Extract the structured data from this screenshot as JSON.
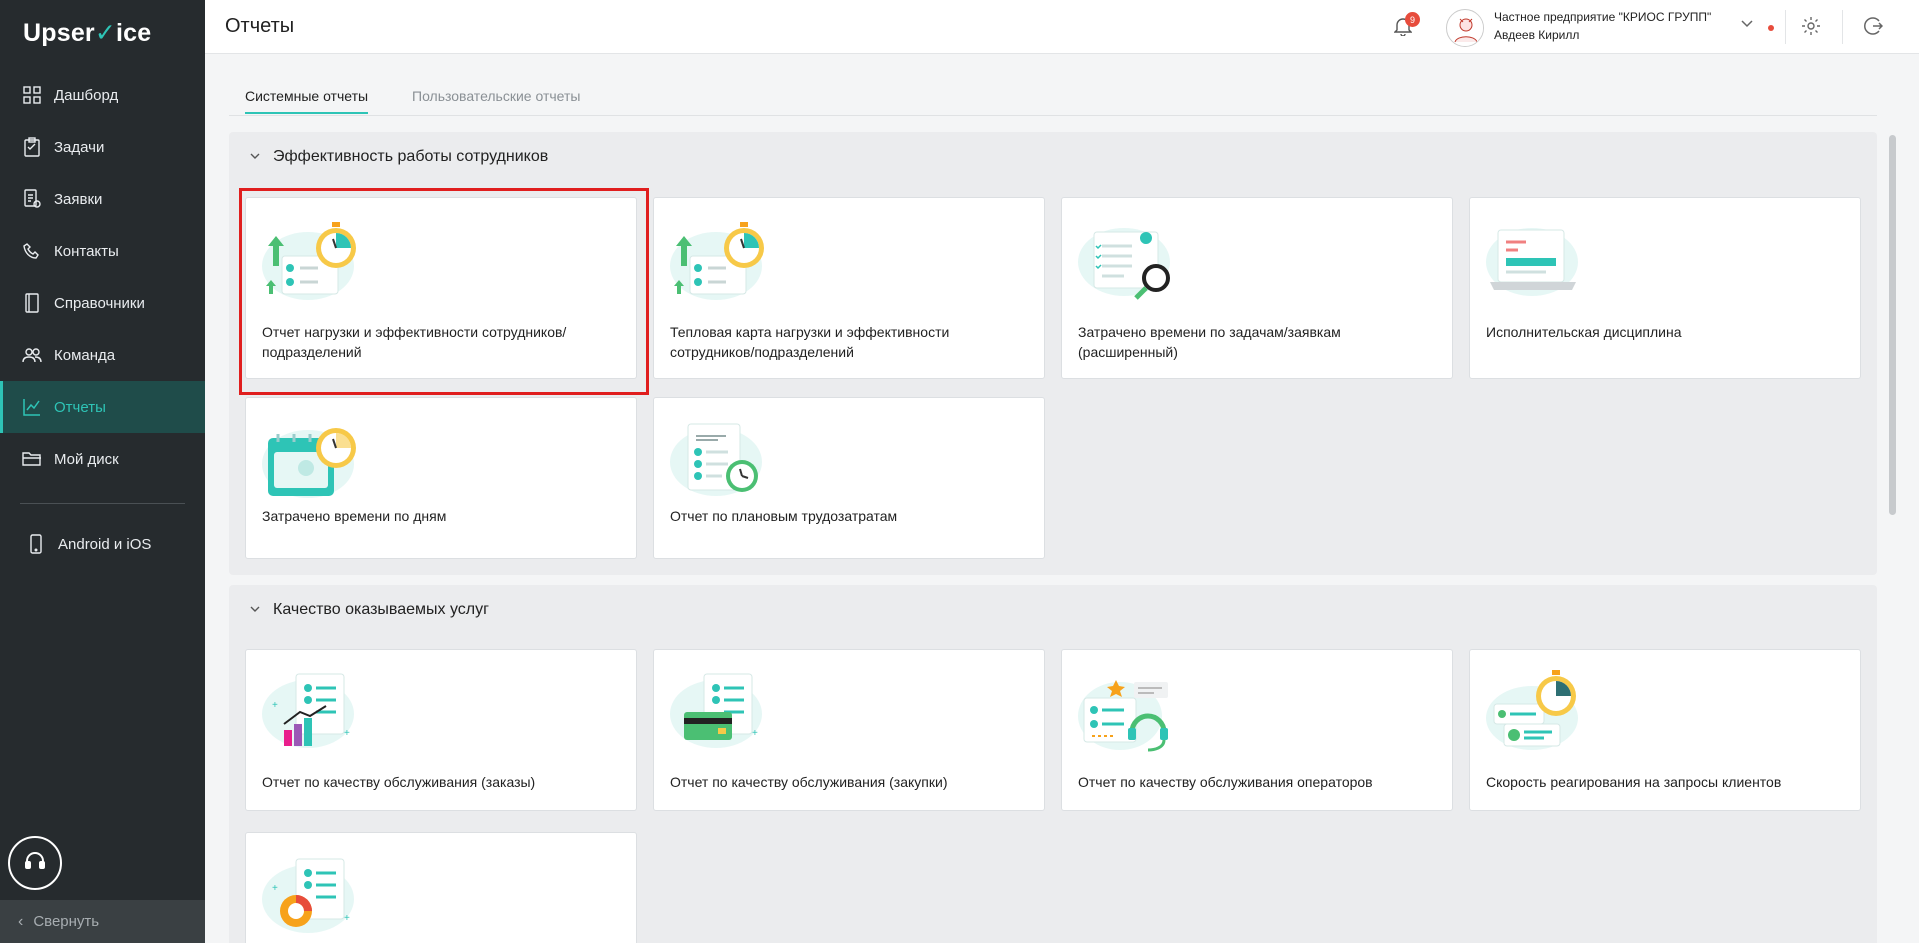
{
  "app": {
    "logo_text_before": "Upser",
    "logo_check": "✓",
    "logo_text_after": "ice"
  },
  "sidebar": {
    "items": [
      {
        "label": "Дашборд",
        "icon": "grid-icon"
      },
      {
        "label": "Задачи",
        "icon": "clipboard-icon"
      },
      {
        "label": "Заявки",
        "icon": "requests-icon"
      },
      {
        "label": "Контакты",
        "icon": "phone-icon"
      },
      {
        "label": "Справочники",
        "icon": "book-icon"
      },
      {
        "label": "Команда",
        "icon": "team-icon"
      },
      {
        "label": "Отчеты",
        "icon": "chart-line-icon",
        "active": true
      },
      {
        "label": "Мой диск",
        "icon": "folder-icon"
      }
    ],
    "mobile": {
      "label": "Android и iOS",
      "icon": "mobile-icon"
    },
    "collapse_label": "Свернуть"
  },
  "header": {
    "title": "Отчеты",
    "notifications_count": "9",
    "company": "Частное предприятие \"КРИОС ГРУПП\"",
    "user": "Авдеев Кирилл"
  },
  "tabs": [
    {
      "label": "Системные отчеты",
      "active": true
    },
    {
      "label": "Пользовательские отчеты",
      "active": false
    }
  ],
  "sections": [
    {
      "title": "Эффективность работы сотрудников",
      "cards": [
        {
          "label": "Отчет нагрузки и эффективности сотрудников/подразделений"
        },
        {
          "label": "Тепловая карта нагрузки и эффективности сотрудников/подразделений"
        },
        {
          "label": "Затрачено времени по задачам/заявкам (расширенный)"
        },
        {
          "label": "Исполнительская дисциплина"
        },
        {
          "label": "Затрачено времени по дням"
        },
        {
          "label": "Отчет по плановым трудозатратам"
        }
      ]
    },
    {
      "title": "Качество оказываемых услуг",
      "cards": [
        {
          "label": "Отчет по качеству обслуживания (заказы)"
        },
        {
          "label": "Отчет по качеству обслуживания (закупки)"
        },
        {
          "label": "Отчет по качеству обслуживания операторов"
        },
        {
          "label": "Скорость реагирования на запросы клиентов"
        }
      ]
    }
  ],
  "colors": {
    "accent": "#2ec4b6",
    "sidebar_bg": "#262b2e",
    "highlight": "#e01e1e"
  }
}
